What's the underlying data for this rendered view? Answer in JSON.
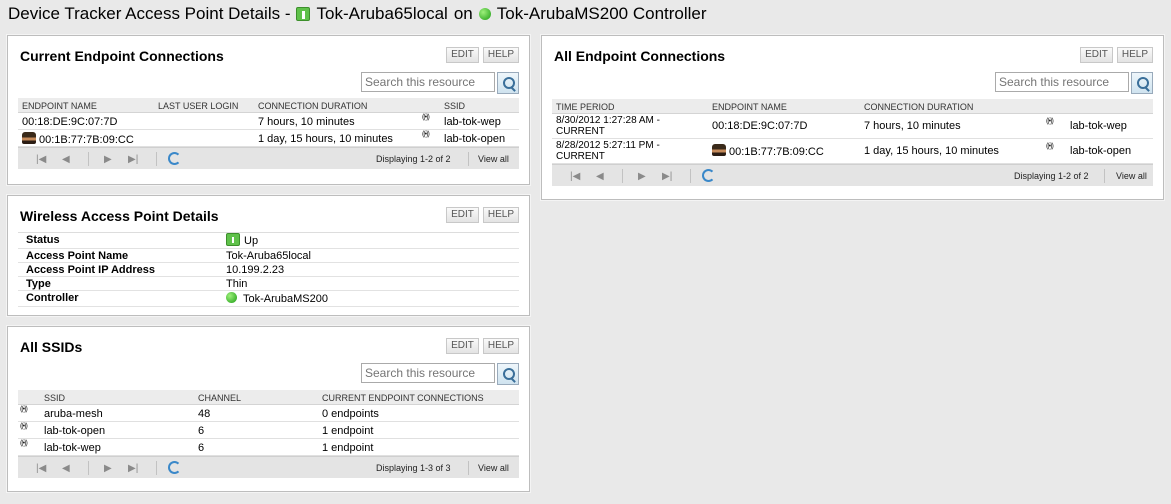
{
  "header": {
    "prefix": "Device Tracker Access Point Details -",
    "ap_name": "Tok-Aruba65local",
    "on": "on",
    "controller": "Tok-ArubaMS200 Controller"
  },
  "common": {
    "edit": "EDIT",
    "help": "HELP",
    "search_placeholder": "Search this resource",
    "view_all": "View all"
  },
  "current": {
    "title": "Current Endpoint Connections",
    "columns": [
      "ENDPOINT NAME",
      "LAST USER LOGIN",
      "CONNECTION DURATION",
      "SSID"
    ],
    "rows": [
      {
        "endpoint": "00:18:DE:9C:07:7D",
        "login": "",
        "duration": "7 hours, 10 minutes",
        "ssid": "lab-tok-wep"
      },
      {
        "endpoint": "00:1B:77:7B:09:CC",
        "login": "",
        "duration": "1 day, 15 hours, 10 minutes",
        "ssid": "lab-tok-open"
      }
    ],
    "displaying": "Displaying 1-2 of 2"
  },
  "wap": {
    "title": "Wireless Access Point Details",
    "rows": [
      {
        "key": "Status",
        "value": "Up"
      },
      {
        "key": "Access Point Name",
        "value": "Tok-Aruba65local"
      },
      {
        "key": "Access Point IP Address",
        "value": "10.199.2.23"
      },
      {
        "key": "Type",
        "value": "Thin"
      },
      {
        "key": "Controller",
        "value": "Tok-ArubaMS200"
      }
    ]
  },
  "ssids": {
    "title": "All SSIDs",
    "columns": [
      "SSID",
      "CHANNEL",
      "CURRENT ENDPOINT CONNECTIONS"
    ],
    "rows": [
      {
        "ssid": "aruba-mesh",
        "channel": "48",
        "conn": "0 endpoints"
      },
      {
        "ssid": "lab-tok-open",
        "channel": "6",
        "conn": "1 endpoint"
      },
      {
        "ssid": "lab-tok-wep",
        "channel": "6",
        "conn": "1 endpoint"
      }
    ],
    "displaying": "Displaying 1-3 of 3"
  },
  "all": {
    "title": "All Endpoint Connections",
    "columns": [
      "TIME PERIOD",
      "ENDPOINT NAME",
      "CONNECTION DURATION"
    ],
    "rows": [
      {
        "period_1": "8/30/2012 1:27:28 AM -",
        "period_2": "CURRENT",
        "endpoint": "00:18:DE:9C:07:7D",
        "duration": "7 hours, 10 minutes",
        "ssid": "lab-tok-wep"
      },
      {
        "period_1": "8/28/2012 5:27:11 PM -",
        "period_2": "CURRENT",
        "endpoint": "00:1B:77:7B:09:CC",
        "duration": "1 day, 15 hours, 10 minutes",
        "ssid": "lab-tok-open"
      }
    ],
    "displaying": "Displaying 1-2 of 2"
  }
}
